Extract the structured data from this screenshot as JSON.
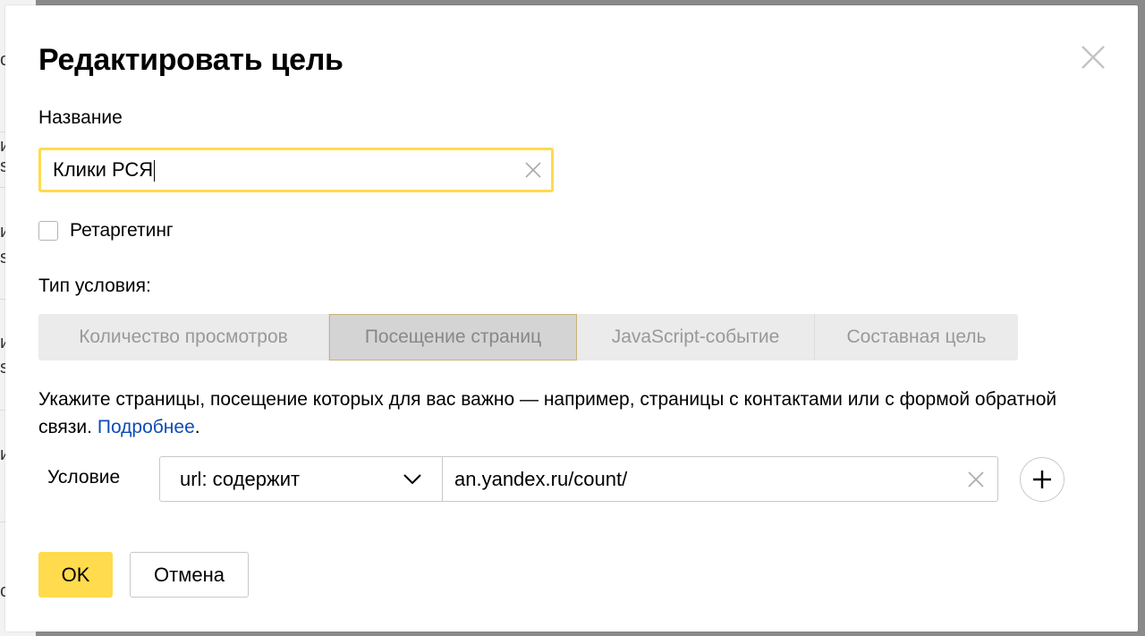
{
  "background_page": {
    "fragments": [
      "о",
      "и",
      "s",
      "и",
      "s",
      "и",
      "s",
      "и",
      "c"
    ]
  },
  "dialog": {
    "title": "Редактировать цель",
    "name_label": "Название",
    "name_value": "Клики РСЯ",
    "retargeting_label": "Ретаргетинг",
    "retargeting_checked": false,
    "condition_type_label": "Тип условия:",
    "tabs": [
      {
        "label": "Количество просмотров",
        "active": false
      },
      {
        "label": "Посещение страниц",
        "active": true
      },
      {
        "label": "JavaScript-событие",
        "active": false
      },
      {
        "label": "Составная цель",
        "active": false
      }
    ],
    "description": "Укажите страницы, посещение которых для вас важно — например, страницы с контактами или с формой обратной связи.",
    "more_link": "Подробнее",
    "more_suffix": ".",
    "condition_label": "Условие",
    "condition_select_value": "url: содержит",
    "condition_url_value": "an.yandex.ru/count/",
    "ok_label": "OK",
    "cancel_label": "Отмена"
  },
  "colors": {
    "accent_yellow": "#ffdb4d",
    "link_blue": "#0c4db5"
  },
  "icons": {
    "close": "close-icon",
    "clear": "clear-icon",
    "chevron": "chevron-down-icon",
    "add": "plus-icon"
  }
}
